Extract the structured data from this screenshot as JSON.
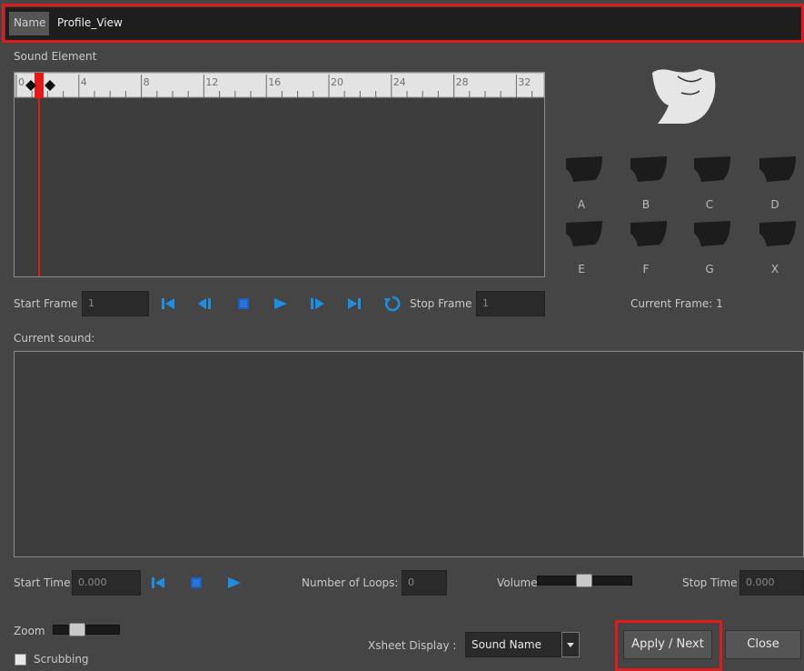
{
  "name_row": {
    "label": "Name",
    "value": "Profile_View"
  },
  "sound_element": {
    "title": "Sound Element",
    "ruler_ticks": [
      "0",
      "4",
      "8",
      "12",
      "16",
      "20",
      "24",
      "28",
      "32"
    ]
  },
  "mouths": [
    "A",
    "B",
    "C",
    "D",
    "E",
    "F",
    "G",
    "X"
  ],
  "playback": {
    "start_frame_label": "Start Frame",
    "start_frame_value": "1",
    "stop_frame_label": "Stop Frame",
    "stop_frame_value": "1",
    "current_frame": "Current Frame: 1"
  },
  "current_sound_label": "Current sound:",
  "bottom": {
    "start_time_label": "Start Time",
    "start_time_value": "0.000",
    "loops_label": "Number of Loops:",
    "loops_value": "0",
    "volume_label": "Volume",
    "stop_time_label": "Stop Time",
    "stop_time_value": "0.000",
    "zoom_label": "Zoom",
    "scrubbing_label": "Scrubbing",
    "xsheet_label": "Xsheet Display :",
    "xsheet_value": "Sound Name",
    "apply_next": "Apply / Next",
    "close": "Close"
  },
  "colors": {
    "accent_icon": "#1e8fe0",
    "highlight_red": "#e01b1b",
    "background": "#454545"
  }
}
